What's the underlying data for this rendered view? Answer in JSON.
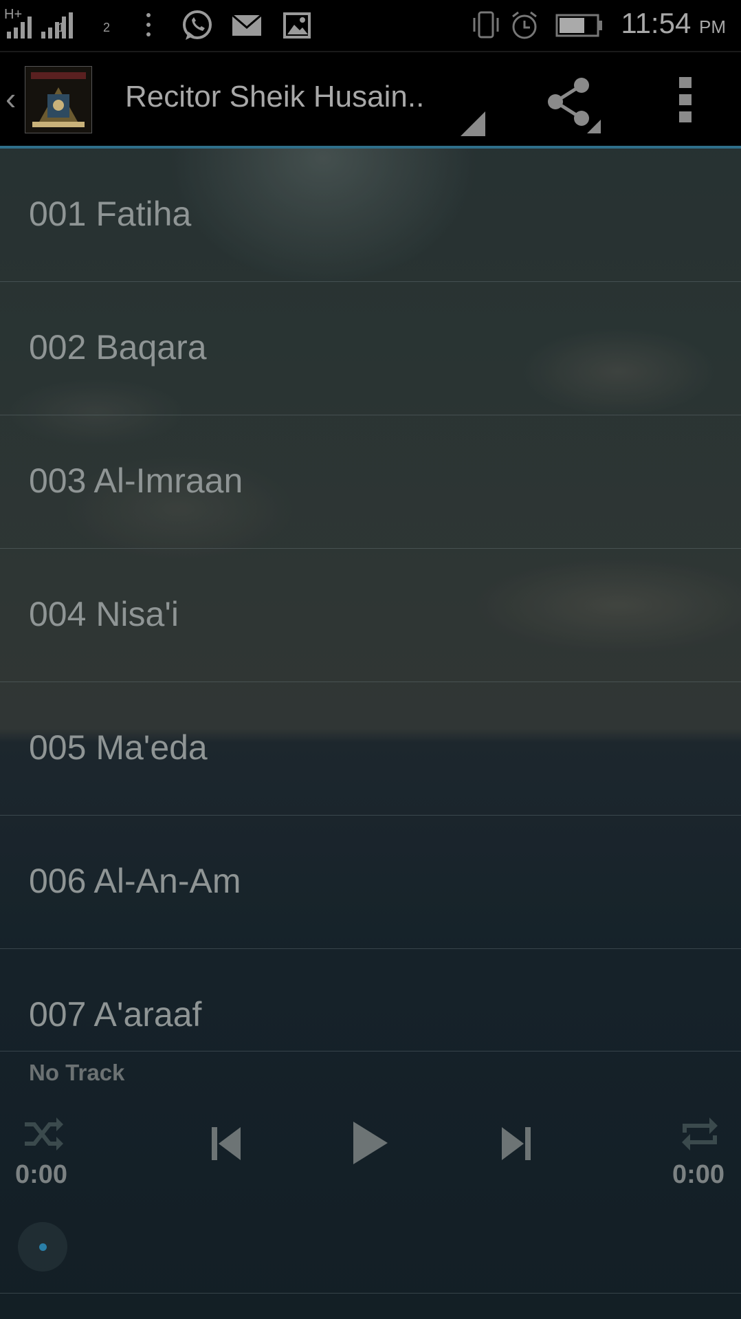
{
  "status_bar": {
    "network": "H+",
    "sim1": "1",
    "sim2": "2",
    "time": "11:54",
    "ampm": "PM"
  },
  "action_bar": {
    "title": "Recitor Sheik Husain..",
    "icons": [
      "back-chevron",
      "app-logo",
      "dropdown-indicator",
      "share-icon",
      "overflow-menu-icon"
    ]
  },
  "tracks": [
    {
      "label": "001 Fatiha"
    },
    {
      "label": "002 Baqara"
    },
    {
      "label": "003 Al-Imraan"
    },
    {
      "label": "004 Nisa'i"
    },
    {
      "label": "005 Ma'eda"
    },
    {
      "label": "006 Al-An-Am"
    },
    {
      "label": "007 A'araaf"
    }
  ],
  "player": {
    "now_playing": "No Track",
    "elapsed": "0:00",
    "duration": "0:00",
    "controls": [
      "shuffle-icon",
      "previous-icon",
      "play-icon",
      "next-icon",
      "repeat-icon"
    ]
  },
  "colors": {
    "accent": "#2f6f8a",
    "text": "#8f9595",
    "bar_bg": "#000000"
  }
}
